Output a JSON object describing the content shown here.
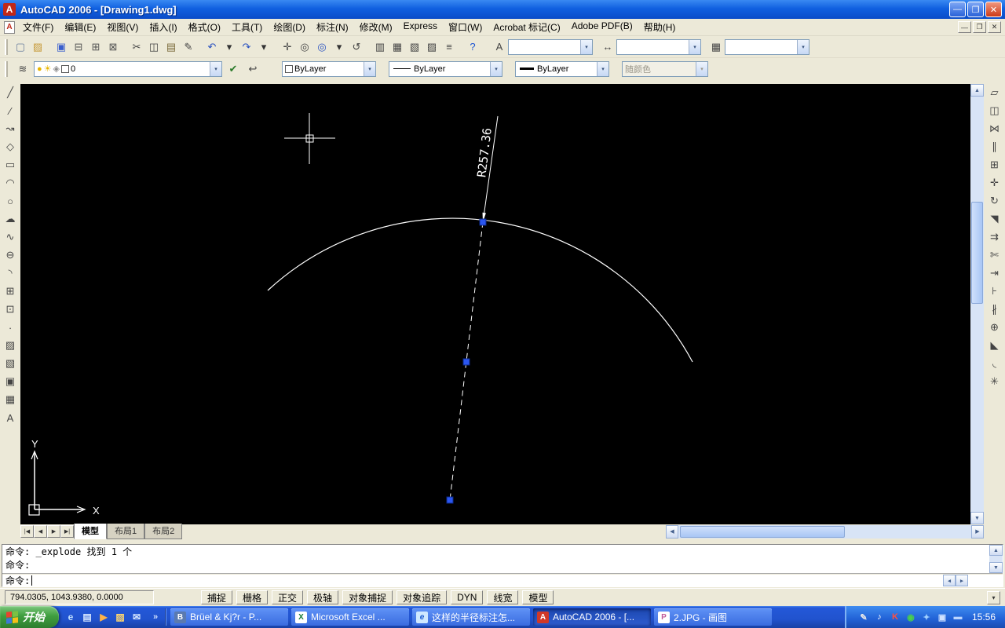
{
  "colors": {
    "titlebar_blue": "#1060e0",
    "canvas_bg": "#000000",
    "grip_blue": "#2b56f0",
    "taskbar_blue": "#2458d8",
    "start_green": "#3f9e3f",
    "toolbar_bg": "#ece9d8"
  },
  "glyphs": {
    "combo_arrow": "▾",
    "up": "▲",
    "down": "▼",
    "left": "◀",
    "right": "▶"
  },
  "titlebar": {
    "icon_letter": "A",
    "title": "AutoCAD 2006 - [Drawing1.dwg]",
    "min_glyph": "—",
    "restore_glyph": "❐",
    "close_glyph": "✕"
  },
  "menubar": {
    "doc_icon_letter": "A",
    "items": [
      {
        "label": "文件(F)"
      },
      {
        "label": "编辑(E)"
      },
      {
        "label": "视图(V)"
      },
      {
        "label": "插入(I)"
      },
      {
        "label": "格式(O)"
      },
      {
        "label": "工具(T)"
      },
      {
        "label": "绘图(D)"
      },
      {
        "label": "标注(N)"
      },
      {
        "label": "修改(M)"
      },
      {
        "label": "Express"
      },
      {
        "label": "窗口(W)"
      },
      {
        "label": "Acrobat 标记(C)"
      },
      {
        "label": "Adobe PDF(B)"
      },
      {
        "label": "帮助(H)"
      }
    ],
    "mdi_min": "—",
    "mdi_restore": "❐",
    "mdi_close": "✕"
  },
  "toolbar_standard": {
    "buttons": [
      {
        "name": "qnew-button",
        "glyph": "▢",
        "color": "#6b7f9e"
      },
      {
        "name": "open-button",
        "glyph": "▨",
        "color": "#c79b3b"
      },
      {
        "name": "save-button",
        "glyph": "▣",
        "color": "#3a5fcd",
        "gap": true
      },
      {
        "name": "plot-button",
        "glyph": "⊟",
        "color": "#555555"
      },
      {
        "name": "plot-preview-button",
        "glyph": "⊞",
        "color": "#555555"
      },
      {
        "name": "publish-button",
        "glyph": "⊠",
        "color": "#555555"
      },
      {
        "name": "cut-button",
        "glyph": "✂",
        "color": "#444444",
        "gap": true
      },
      {
        "name": "copy-button",
        "glyph": "◫",
        "color": "#444444"
      },
      {
        "name": "paste-button",
        "glyph": "▤",
        "color": "#7a6a3a"
      },
      {
        "name": "match-properties-button",
        "glyph": "✎",
        "color": "#444444"
      },
      {
        "name": "undo-button",
        "glyph": "↶",
        "color": "#2a52c0",
        "gap": true
      },
      {
        "name": "undo-dropdown",
        "glyph": "▾",
        "color": "#333333"
      },
      {
        "name": "redo-button",
        "glyph": "↷",
        "color": "#2a52c0"
      },
      {
        "name": "redo-dropdown",
        "glyph": "▾",
        "color": "#333333"
      },
      {
        "name": "pan-button",
        "glyph": "✛",
        "color": "#444444",
        "gap": true
      },
      {
        "name": "zoom-realtime-button",
        "glyph": "◎",
        "color": "#444444"
      },
      {
        "name": "zoom-window-button",
        "glyph": "◎",
        "color": "#2a52c0"
      },
      {
        "name": "zoom-flyout-arrow",
        "glyph": "▾",
        "color": "#333333"
      },
      {
        "name": "zoom-previous-button",
        "glyph": "↺",
        "color": "#444444"
      },
      {
        "name": "properties-button",
        "glyph": "▥",
        "color": "#444444",
        "gap": true
      },
      {
        "name": "designcenter-button",
        "glyph": "▦",
        "color": "#444444"
      },
      {
        "name": "tool-palettes-button",
        "glyph": "▧",
        "color": "#444444"
      },
      {
        "name": "sheet-set-manager-button",
        "glyph": "▨",
        "color": "#444444"
      },
      {
        "name": "quickcalc-button",
        "glyph": "≡",
        "color": "#444444"
      },
      {
        "name": "help-button",
        "glyph": "?",
        "color": "#1b54d2",
        "gap": true
      }
    ]
  },
  "toolbar_styles": {
    "text_icon": "A",
    "dim_icon": "↔",
    "table_icon": "▦",
    "text_value": "",
    "dim_value": "",
    "table_value": ""
  },
  "toolbar_layers": {
    "layers_manager_glyph": "≋",
    "bulb_glyph": "●",
    "sun_glyph": "☀",
    "lock_glyph": "◈",
    "layer_value": "0",
    "make_current_glyph": "✔",
    "layer_previous_glyph": "↩",
    "color_value": "ByLayer",
    "linetype_value": "ByLayer",
    "lineweight_value": "ByLayer",
    "plotstyle_value": "随颜色"
  },
  "draw_toolbar": {
    "buttons": [
      {
        "name": "line-tool",
        "glyph": "╱"
      },
      {
        "name": "construction-line-tool",
        "glyph": "∕"
      },
      {
        "name": "polyline-tool",
        "glyph": "↝"
      },
      {
        "name": "polygon-tool",
        "glyph": "◇"
      },
      {
        "name": "rectangle-tool",
        "glyph": "▭"
      },
      {
        "name": "arc-tool",
        "glyph": "◠"
      },
      {
        "name": "circle-tool",
        "glyph": "○"
      },
      {
        "name": "revcloud-tool",
        "glyph": "☁"
      },
      {
        "name": "spline-tool",
        "glyph": "∿"
      },
      {
        "name": "ellipse-tool",
        "glyph": "⊖"
      },
      {
        "name": "ellipse-arc-tool",
        "glyph": "◝"
      },
      {
        "name": "insert-block-tool",
        "glyph": "⊞"
      },
      {
        "name": "make-block-tool",
        "glyph": "⊡"
      },
      {
        "name": "point-tool",
        "glyph": "∙"
      },
      {
        "name": "hatch-tool",
        "glyph": "▨"
      },
      {
        "name": "gradient-tool",
        "glyph": "▧"
      },
      {
        "name": "region-tool",
        "glyph": "▣"
      },
      {
        "name": "table-tool",
        "glyph": "▦"
      },
      {
        "name": "mtext-tool",
        "glyph": "A"
      }
    ]
  },
  "modify_toolbar": {
    "buttons": [
      {
        "name": "erase-tool",
        "glyph": "▱"
      },
      {
        "name": "copy-tool",
        "glyph": "◫"
      },
      {
        "name": "mirror-tool",
        "glyph": "⋈"
      },
      {
        "name": "offset-tool",
        "glyph": "∥"
      },
      {
        "name": "array-tool",
        "glyph": "⊞"
      },
      {
        "name": "move-tool",
        "glyph": "✛"
      },
      {
        "name": "rotate-tool",
        "glyph": "↻"
      },
      {
        "name": "scale-tool",
        "glyph": "◥"
      },
      {
        "name": "stretch-tool",
        "glyph": "⇉"
      },
      {
        "name": "trim-tool",
        "glyph": "✄"
      },
      {
        "name": "extend-tool",
        "glyph": "⇥"
      },
      {
        "name": "break-at-point-tool",
        "glyph": "⊦"
      },
      {
        "name": "break-tool",
        "glyph": "∦"
      },
      {
        "name": "join-tool",
        "glyph": "⊕"
      },
      {
        "name": "chamfer-tool",
        "glyph": "◣"
      },
      {
        "name": "fillet-tool",
        "glyph": "◟"
      },
      {
        "name": "explode-tool",
        "glyph": "✳"
      }
    ]
  },
  "canvas": {
    "dimension_label": "R257.36",
    "ucs_x": "X",
    "ucs_y": "Y"
  },
  "tabs": {
    "items": [
      "模型",
      "布局1",
      "布局2"
    ],
    "nav": [
      "|◀",
      "◀",
      "▶",
      "▶|"
    ]
  },
  "command": {
    "history": [
      "命令: _explode 找到 1 个",
      "命令:"
    ],
    "prompt": "命令:"
  },
  "statusbar": {
    "coords": "794.0305, 1043.9380, 0.0000",
    "toggles": [
      "捕捉",
      "栅格",
      "正交",
      "极轴",
      "对象捕捉",
      "对象追踪",
      "DYN",
      "线宽",
      "模型"
    ]
  },
  "taskbar": {
    "start_label": "开始",
    "ql_chevron": "»",
    "quicklaunch": [
      {
        "name": "quicklaunch-ie-icon",
        "glyph": "e",
        "color": "#bfe0ff"
      },
      {
        "name": "quicklaunch-show-desktop-icon",
        "glyph": "▤",
        "color": "#d8e8ff"
      },
      {
        "name": "quicklaunch-media-player-icon",
        "glyph": "▶",
        "color": "#ffb347"
      },
      {
        "name": "quicklaunch-folder-icon",
        "glyph": "▨",
        "color": "#ffd76e"
      },
      {
        "name": "quicklaunch-mail-icon",
        "glyph": "✉",
        "color": "#d8e8ff"
      }
    ],
    "tasks": [
      {
        "label": "Brüel & Kj?r - P...",
        "icon_letter": "B"
      },
      {
        "label": "Microsoft Excel ...",
        "icon_letter": "X"
      },
      {
        "label": "这样的半径标注怎...",
        "icon_letter": "e"
      },
      {
        "label": "AutoCAD 2006 - [...",
        "icon_letter": "A"
      },
      {
        "label": "2.JPG - 画图",
        "icon_letter": "P"
      }
    ],
    "tray_icons": [
      {
        "name": "tray-pen-icon",
        "glyph": "✎",
        "color": "#e8e8e8"
      },
      {
        "name": "tray-volume-icon",
        "glyph": "♪",
        "color": "#ffffff"
      },
      {
        "name": "tray-kingsoft-icon",
        "glyph": "K",
        "color": "#ff5040"
      },
      {
        "name": "tray-shield-icon",
        "glyph": "◉",
        "color": "#4ad04a"
      },
      {
        "name": "tray-msn-icon",
        "glyph": "✦",
        "color": "#9fd0ff"
      },
      {
        "name": "tray-display-icon",
        "glyph": "▣",
        "color": "#cfe2ff"
      },
      {
        "name": "tray-network-icon",
        "glyph": "▬",
        "color": "#bcd6ff"
      }
    ],
    "clock": "15:56"
  }
}
